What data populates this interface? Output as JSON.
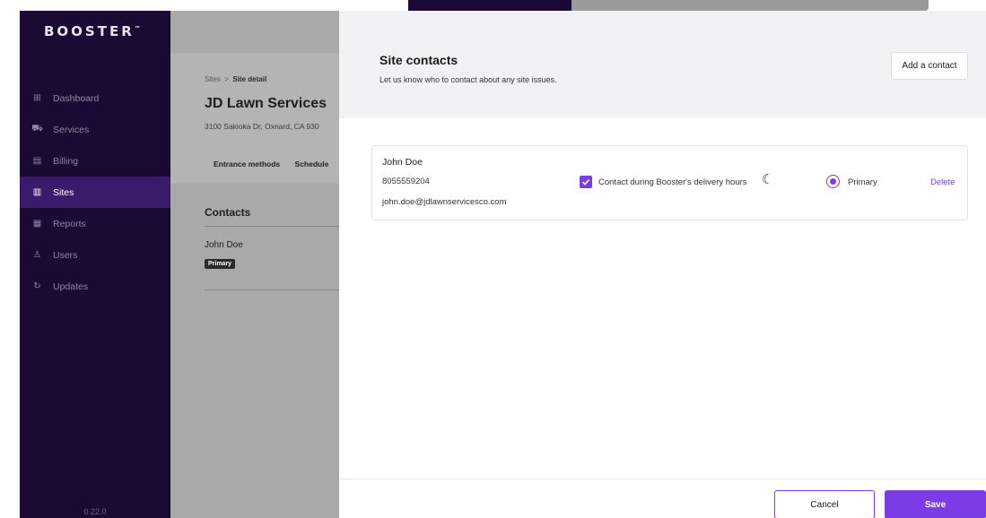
{
  "app": {
    "logo": "BOOSTER",
    "logo_mark": "™",
    "version": "0.22.0"
  },
  "sidebar": {
    "items": [
      {
        "label": "Dashboard",
        "icon": "dashboard-icon",
        "glyph": "⊞",
        "active": false
      },
      {
        "label": "Services",
        "icon": "services-icon",
        "glyph": "⛟",
        "active": false
      },
      {
        "label": "Billing",
        "icon": "billing-icon",
        "glyph": "▤",
        "active": false
      },
      {
        "label": "Sites",
        "icon": "sites-icon",
        "glyph": "▥",
        "active": true
      },
      {
        "label": "Reports",
        "icon": "reports-icon",
        "glyph": "▦",
        "active": false
      },
      {
        "label": "Users",
        "icon": "users-icon",
        "glyph": "♙",
        "active": false
      },
      {
        "label": "Updates",
        "icon": "updates-icon",
        "glyph": "↻",
        "active": false
      }
    ]
  },
  "page": {
    "breadcrumb_root": "Sites",
    "breadcrumb_sep": ">",
    "breadcrumb_current": "Site detail",
    "title": "JD Lawn Services",
    "address": "3100 Sakioka Dr, Oxnard, CA 930",
    "tabs": [
      "Entrance methods",
      "Schedule"
    ],
    "contacts_heading": "Contacts",
    "contact_name": "John Doe",
    "contact_badge": "Primary"
  },
  "drawer": {
    "title": "Site contacts",
    "subtitle": "Let us know who to contact about any site issues.",
    "add_button": "Add a contact",
    "contact": {
      "name": "John Doe",
      "phone": "8055559204",
      "email": "john.doe@jdlawnservicesco.com",
      "delivery_hours_label": "Contact during Booster's delivery hours",
      "delivery_hours_checked": true,
      "primary_label": "Primary",
      "primary_selected": true,
      "delete_label": "Delete"
    },
    "cancel_button": "Cancel",
    "save_button": "Save"
  },
  "colors": {
    "accent": "#7b3be5",
    "sidebar_bg": "#1b0a33",
    "sidebar_active": "#3a1a6a"
  }
}
